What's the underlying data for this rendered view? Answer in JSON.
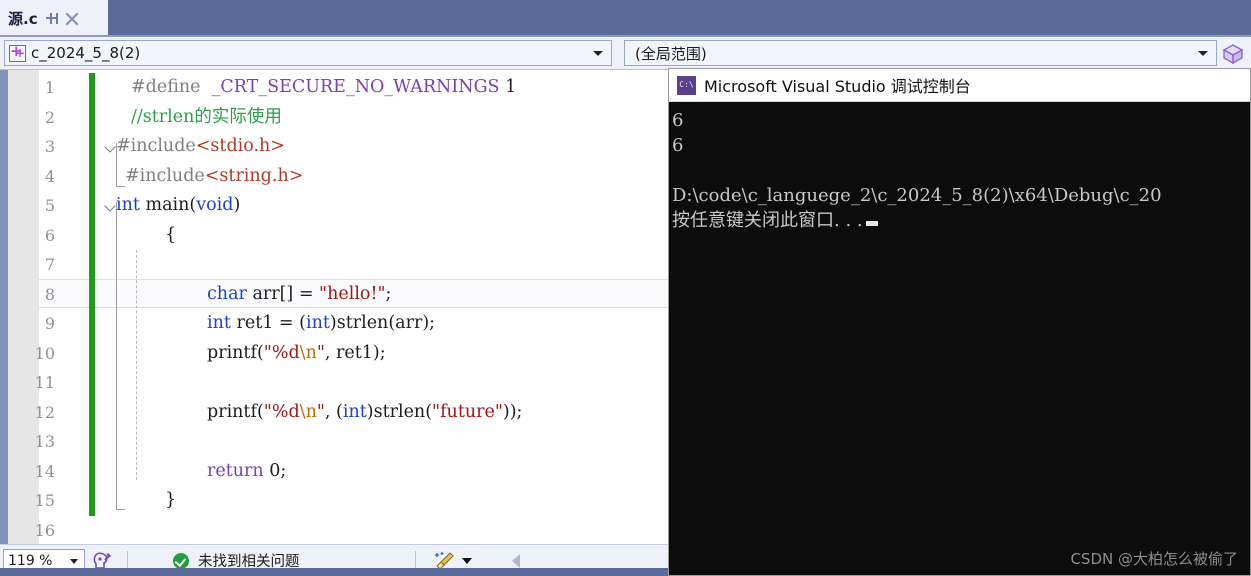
{
  "tab": {
    "title": "源.c",
    "pin_icon": "pin-icon",
    "close_icon": "close-icon"
  },
  "navbar": {
    "project_combo": {
      "value": "c_2024_5_8(2)",
      "icon": "project-plus-icon"
    },
    "scope_combo": {
      "value": "(全局范围)"
    },
    "right_icon": "cube-icon"
  },
  "editor": {
    "zoom_percent": "119 %",
    "lines": [
      {
        "n": "1",
        "text": "#define  _CRT_SECURE_NO_WARNINGS 1"
      },
      {
        "n": "2",
        "text": "//strlen的实际使用"
      },
      {
        "n": "3",
        "text": "#include<stdio.h>"
      },
      {
        "n": "4",
        "text": "#include<string.h>"
      },
      {
        "n": "5",
        "text": "int main(void)"
      },
      {
        "n": "6",
        "text": "{"
      },
      {
        "n": "7",
        "text": ""
      },
      {
        "n": "8",
        "text": "    char arr[] = \"hello!\";"
      },
      {
        "n": "9",
        "text": "    int ret1 = (int)strlen(arr);"
      },
      {
        "n": "10",
        "text": "    printf(\"%d\\n\", ret1);"
      },
      {
        "n": "11",
        "text": ""
      },
      {
        "n": "12",
        "text": "    printf(\"%d\\n\", (int)strlen(\"future\"));"
      },
      {
        "n": "13",
        "text": ""
      },
      {
        "n": "14",
        "text": "    return 0;"
      },
      {
        "n": "15",
        "text": "}"
      },
      {
        "n": "16",
        "text": ""
      }
    ],
    "tokens": {
      "l1_define": "#define",
      "l1_macro": "_CRT_SECURE_NO_WARNINGS",
      "l1_num": "1",
      "l2_comment": "//strlen的实际使用",
      "l3_include": "#include",
      "l3_header": "<stdio.h>",
      "l4_include": "#include",
      "l4_header": "<string.h>",
      "l5_int": "int",
      "l5_main": " main",
      "l5_lp": "(",
      "l5_void": "void",
      "l5_rp": ")",
      "l6_brace": "{",
      "l8_char": "char",
      "l8_mid": " arr[] = ",
      "l8_str": "\"hello!\"",
      "l8_semi": ";",
      "l9_int": "int",
      "l9_mid": " ret1 = (",
      "l9_cast": "int",
      "l9_rest": ")strlen(arr);",
      "l10_a": "printf(",
      "l10_fmt": "\"%d",
      "l10_esc": "\\n",
      "l10_fmt2": "\"",
      "l10_b": ", ret1);",
      "l12_a": "printf(",
      "l12_fmt": "\"%d",
      "l12_esc": "\\n",
      "l12_fmt2": "\"",
      "l12_b": ", (",
      "l12_cast": "int",
      "l12_c": ")strlen(",
      "l12_str": "\"future\"",
      "l12_d": "));",
      "l14_return": "return",
      "l14_num": " 0;",
      "l15_brace": "}"
    }
  },
  "statusbar": {
    "zoom": "119 %",
    "intellisense_icon": "intellisense-head-icon",
    "ok_icon": "ok-circle-icon",
    "message": "未找到相关问题",
    "broom_icon": "cleanup-broom-icon",
    "broom_arrow_icon": "chevron-down-icon",
    "back_chevron_icon": "chevron-left-icon"
  },
  "console": {
    "icon": "console-app-icon",
    "title": "Microsoft Visual Studio 调试控制台",
    "lines": [
      "6",
      "6",
      "",
      "D:\\code\\c_languege_2\\c_2024_5_8(2)\\x64\\Debug\\c_20",
      "按任意键关闭此窗口. . ."
    ]
  },
  "watermark": {
    "text": "CSDN @大柏怎么被偷了"
  },
  "colors": {
    "titlebar": "#5b6a99",
    "chrome": "#eef1f8",
    "changebar_green": "#1c9b1c",
    "comment_green": "#2e9e4a",
    "keyword_blue": "#1c42c8",
    "string_red": "#a31515",
    "macro_purple": "#7a3fb5",
    "console_bg": "#0c0c0c"
  }
}
